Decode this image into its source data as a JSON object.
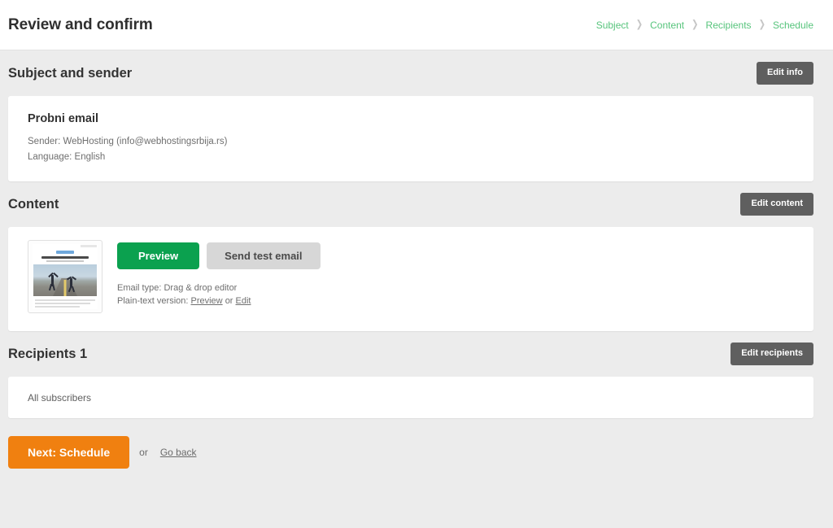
{
  "header": {
    "title": "Review and confirm",
    "breadcrumb": [
      {
        "label": "Subject"
      },
      {
        "label": "Content"
      },
      {
        "label": "Recipients"
      },
      {
        "label": "Schedule"
      }
    ],
    "breadcrumb_separator": "❯"
  },
  "subject_section": {
    "title": "Subject and sender",
    "edit_button": "Edit info",
    "email_subject": "Probni email",
    "sender_line": "Sender: WebHosting (info@webhostingsrbija.rs)",
    "language_line": "Language: English"
  },
  "content_section": {
    "title": "Content",
    "edit_button": "Edit content",
    "preview_button": "Preview",
    "send_test_button": "Send test email",
    "email_type_label": "Email type: Drag & drop editor",
    "plain_text_prefix": "Plain-text version:",
    "plain_text_preview_link": "Preview",
    "plain_text_or": "or",
    "plain_text_edit_link": "Edit",
    "thumbnail_alt": "email-template-thumbnail"
  },
  "recipients_section": {
    "title": "Recipients 1",
    "edit_button": "Edit recipients",
    "list_value": "All subscribers"
  },
  "footer": {
    "next_button": "Next: Schedule",
    "or_text": "or",
    "go_back_link": "Go back"
  },
  "colors": {
    "breadcrumb_green": "#57c47c",
    "preview_green": "#0ba14f",
    "next_orange": "#f08010",
    "edit_gray": "#5f5f5f",
    "page_bg": "#ececec",
    "card_bg": "#ffffff"
  }
}
